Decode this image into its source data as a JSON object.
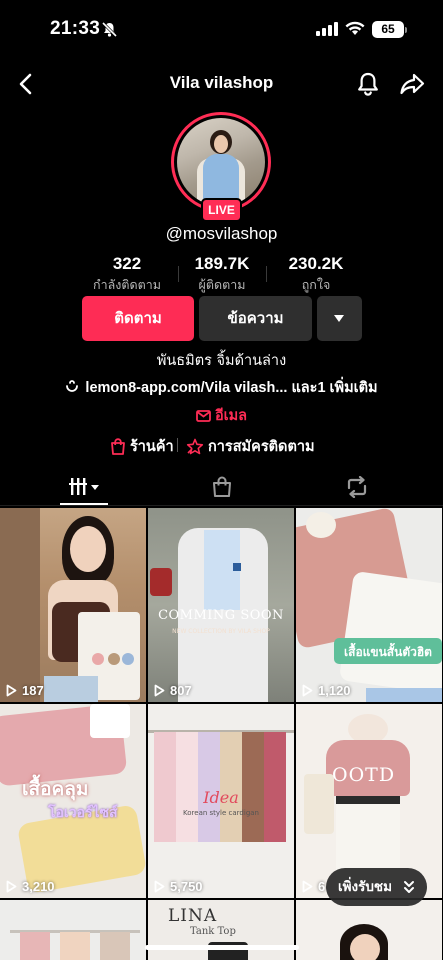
{
  "status": {
    "time": "21:33",
    "battery": "65"
  },
  "nav": {
    "title": "Vila vilashop"
  },
  "profile": {
    "live_label": "LIVE",
    "username": "@mosvilashop",
    "stats": [
      {
        "value": "322",
        "label": "กำลังติดตาม"
      },
      {
        "value": "189.7K",
        "label": "ผู้ติดตาม"
      },
      {
        "value": "230.2K",
        "label": "ถูกใจ"
      }
    ],
    "follow_label": "ติดตาม",
    "message_label": "ข้อความ",
    "bio": "พันธมิตร จิ้มด้านล่าง",
    "link": "lemon8-app.com/Vila vilash... และ1 เพิ่มเติม",
    "email_label": "อีเมล",
    "shop_label": "ร้านค้า",
    "subscribe_label": "การสมัครติดตาม"
  },
  "tabs": [
    {
      "icon": "grid-icon"
    },
    {
      "icon": "shop-bag-icon"
    },
    {
      "icon": "repost-icon"
    }
  ],
  "videos": [
    {
      "views": "187",
      "overlay": ""
    },
    {
      "views": "807",
      "overlay": "COMMING SOON",
      "overlay_sub": "NEW COLLECTION BY VILA SHOP"
    },
    {
      "views": "1,120",
      "overlay": "เสื้อแขนสั้นตัวฮิต"
    },
    {
      "views": "3,210",
      "overlay": "เสื้อคลุม",
      "overlay_sub": "โอเวอร์ไซส์"
    },
    {
      "views": "5,750",
      "overlay": "Idea",
      "overlay_sub": "Korean style cardigan"
    },
    {
      "views": "6",
      "overlay": "OOTD"
    },
    {
      "views": "",
      "overlay": ""
    },
    {
      "views": "",
      "overlay": "LINA",
      "overlay_sub": "Tank Top"
    },
    {
      "views": "",
      "overlay": ""
    }
  ],
  "more_pill": "เพิ่งรับชม",
  "colors": {
    "accent": "#fe2c55",
    "background": "#000000",
    "button_dark": "#2f2f2f"
  }
}
